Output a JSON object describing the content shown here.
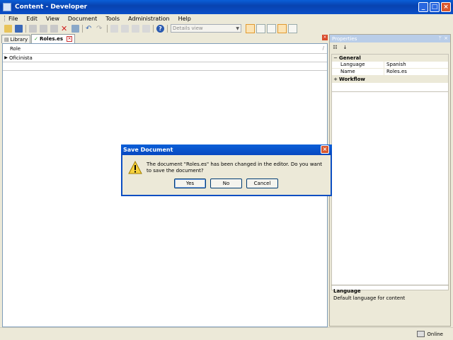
{
  "window": {
    "title": "Content - Developer"
  },
  "menu": [
    "File",
    "Edit",
    "View",
    "Document",
    "Tools",
    "Administration",
    "Help"
  ],
  "toolbar": {
    "view_dropdown_placeholder": "Details view"
  },
  "tabs": [
    {
      "label": "Library"
    },
    {
      "label": "Roles.es"
    }
  ],
  "grid": {
    "column": "Role",
    "rows": [
      "Oficinista"
    ]
  },
  "properties": {
    "title": "Properties",
    "categories": [
      {
        "name": "General",
        "expanded": true,
        "rows": [
          {
            "key": "Language",
            "value": "Spanish"
          },
          {
            "key": "Name",
            "value": "Roles.es"
          }
        ]
      },
      {
        "name": "Workflow",
        "expanded": false
      }
    ],
    "description": {
      "title": "Language",
      "text": "Default language for content"
    }
  },
  "status": {
    "text": "Online"
  },
  "dialog": {
    "title": "Save Document",
    "message": "The document \"Roles.es\" has been changed in the editor. Do you want to save the document?",
    "buttons": {
      "yes": "Yes",
      "no": "No",
      "cancel": "Cancel"
    }
  },
  "colors": {
    "titlebar": "#0a4fc8",
    "chrome": "#ece9d8",
    "accent": "#fbe3b4"
  }
}
